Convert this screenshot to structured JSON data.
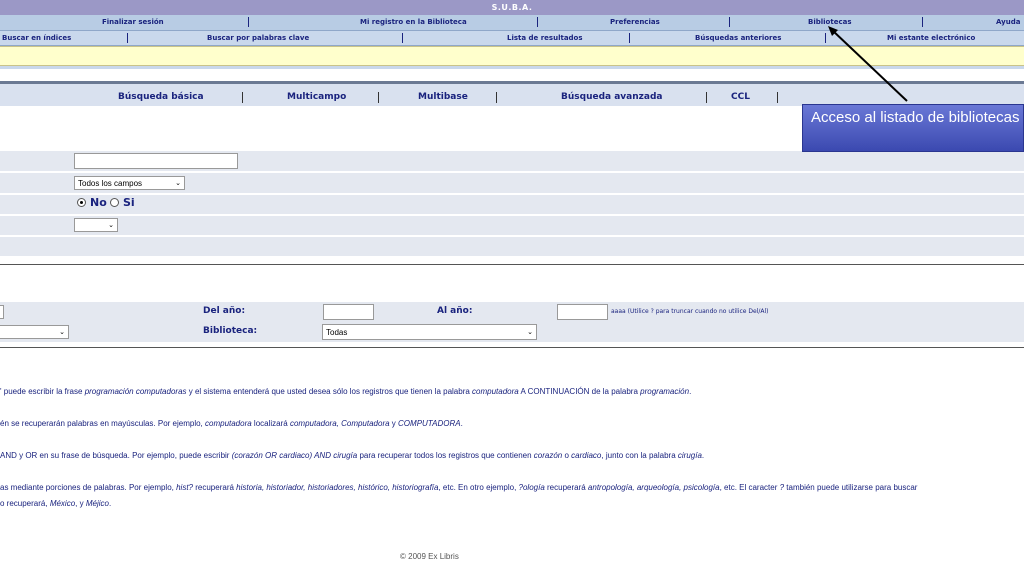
{
  "banner": {
    "title": "S.U.B.A."
  },
  "nav_main": {
    "finalizar": "Finalizar sesión",
    "registro": "Mi registro en la Biblioteca",
    "preferencias": "Preferencias",
    "bibliotecas": "Bibliotecas",
    "ayuda": "Ayuda"
  },
  "nav_sub": {
    "indices": "Buscar en índices",
    "palabras": "Buscar por palabras clave",
    "lista": "Lista de resultados",
    "anteriores": "Búsquedas anteriores",
    "estante": "Mi estante electrónico"
  },
  "tabs": {
    "basica": "Búsqueda básica",
    "multicampo": "Multicampo",
    "multibase": "Multibase",
    "avanzada": "Búsqueda avanzada",
    "ccl": "CCL"
  },
  "form": {
    "field_select": "Todos los campos",
    "radio_no": "No",
    "radio_si": "Si",
    "del_ano_label": "Del año:",
    "al_ano_label": "Al año:",
    "year_hint": "aaaa (Utilice ? para truncar cuando no utilice Del/Al)",
    "biblioteca_label": "Biblioteca:",
    "biblioteca_select": "Todas"
  },
  "help": {
    "p1a": "' puede escribir la frase ",
    "p1b": "programación computadoras",
    "p1c": " y el sistema entenderá que usted desea sólo los registros que tienen la palabra ",
    "p1d": "computadora",
    "p1e": " A CONTINUACIÓN de la palabra ",
    "p1f": "programación",
    "p1g": ".",
    "p2a": "én se recuperarán palabras en mayúsculas. Por ejemplo, ",
    "p2b": "computadora",
    "p2c": " localizará ",
    "p2d": "computadora, Computadora",
    "p2e": " y ",
    "p2f": "COMPUTADORA",
    "p2g": ".",
    "p3a": "AND y OR en su frase de búsqueda. Por ejemplo, puede escribir ",
    "p3b": "(corazón OR cardiaco) AND cirugía",
    "p3c": " para recuperar todos los registros que contienen ",
    "p3d": "corazón",
    "p3e": " o ",
    "p3f": "cardiaco",
    "p3g": ", junto con la palabra ",
    "p3h": "cirugía",
    "p3i": ".",
    "p4a": "as mediante porciones de palabras. Por ejemplo, ",
    "p4b": "hist?",
    "p4c": " recuperará ",
    "p4d": "historia, historiador, historiadores, histórico, historiografía",
    "p4e": ", etc. En otro ejemplo, ",
    "p4f": "?ología",
    "p4g": " recuperará ",
    "p4h": "antropología, arqueología, psicología",
    "p4i": ", etc. El caracter ",
    "p4j": "?",
    "p4k": " también puede utilizarse para buscar",
    "p5a": "o recuperará, ",
    "p5b": "México",
    "p5c": ", y ",
    "p5d": "Méjico",
    "p5e": "."
  },
  "callout": {
    "text": "Acceso al listado de bibliotecas"
  },
  "footer": {
    "text": "© 2009 Ex Libris"
  }
}
